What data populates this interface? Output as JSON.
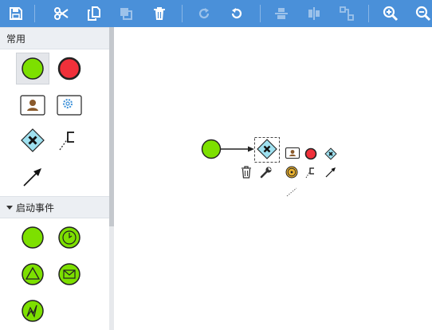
{
  "toolbar": {
    "buttons": [
      {
        "icon": "save-icon",
        "enabled": true
      },
      {
        "icon": "cut-icon",
        "enabled": true
      },
      {
        "icon": "copy-icon",
        "enabled": true
      },
      {
        "icon": "paste-icon",
        "enabled": false
      },
      {
        "icon": "delete-icon",
        "enabled": true
      },
      {
        "icon": "redo-icon",
        "enabled": false
      },
      {
        "icon": "undo-icon",
        "enabled": true
      },
      {
        "icon": "align-horizontal-icon",
        "enabled": false
      },
      {
        "icon": "align-vertical-icon",
        "enabled": false
      },
      {
        "icon": "connector-icon",
        "enabled": false
      },
      {
        "icon": "zoom-in-icon",
        "enabled": true
      },
      {
        "icon": "zoom-out-icon",
        "enabled": true
      }
    ]
  },
  "sidebar": {
    "sections": [
      {
        "title": "常用",
        "expanded": true,
        "items": [
          {
            "icon": "start-event-icon",
            "selected": true
          },
          {
            "icon": "end-event-icon",
            "selected": false
          },
          {
            "icon": "user-task-icon",
            "selected": false
          },
          {
            "icon": "service-task-icon",
            "selected": false
          },
          {
            "icon": "exclusive-gateway-icon",
            "selected": false
          },
          {
            "icon": "annotation-icon",
            "selected": false
          },
          {
            "icon": "sequence-flow-icon",
            "selected": false
          }
        ]
      },
      {
        "title": "启动事件",
        "expanded": true,
        "items": [
          {
            "icon": "start-none-event-icon"
          },
          {
            "icon": "start-timer-event-icon"
          },
          {
            "icon": "start-signal-event-icon"
          },
          {
            "icon": "start-message-event-icon"
          },
          {
            "icon": "start-error-event-icon"
          }
        ]
      }
    ]
  },
  "canvas": {
    "elements": [
      "start-event",
      "sequence-flow",
      "exclusive-gateway"
    ],
    "selected": "exclusive-gateway",
    "context_pad": [
      "delete-icon",
      "wrench-icon",
      "user-task-icon",
      "end-event-icon",
      "exclusive-gateway-icon",
      "intermediate-event-icon",
      "annotation-icon",
      "sequence-flow-icon",
      "association-icon"
    ]
  },
  "colors": {
    "toolbar_bg": "#4a90d9",
    "event_green": "#7de000",
    "end_red": "#f0303a",
    "gateway_cyan": "#9fe1f0",
    "section_header_bg": "#eceff3"
  }
}
